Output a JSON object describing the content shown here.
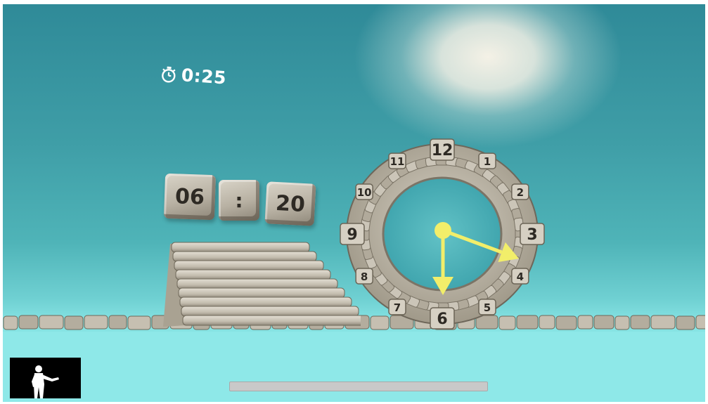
{
  "hud": {
    "timer_icon": "stopwatch-icon",
    "timer_text": "0:25"
  },
  "digital_time": {
    "hours": "06",
    "separator": ":",
    "minutes": "20"
  },
  "clock": {
    "numerals": [
      "12",
      "1",
      "2",
      "3",
      "4",
      "5",
      "6",
      "7",
      "8",
      "9",
      "10",
      "11"
    ],
    "hands_color": "#f2ee6a",
    "hour_hand_points_to": "3",
    "minute_hand_points_to": "6"
  },
  "progress": {
    "fraction": 0.0
  },
  "camera_preview": {
    "icon": "player-silhouette-icon"
  },
  "colors": {
    "sky_top": "#2f8a98",
    "sky_glow": "#f4f1e6",
    "floor": "#8ee8e8",
    "stone": "#b8b1a3",
    "hands": "#f2ee6a"
  }
}
